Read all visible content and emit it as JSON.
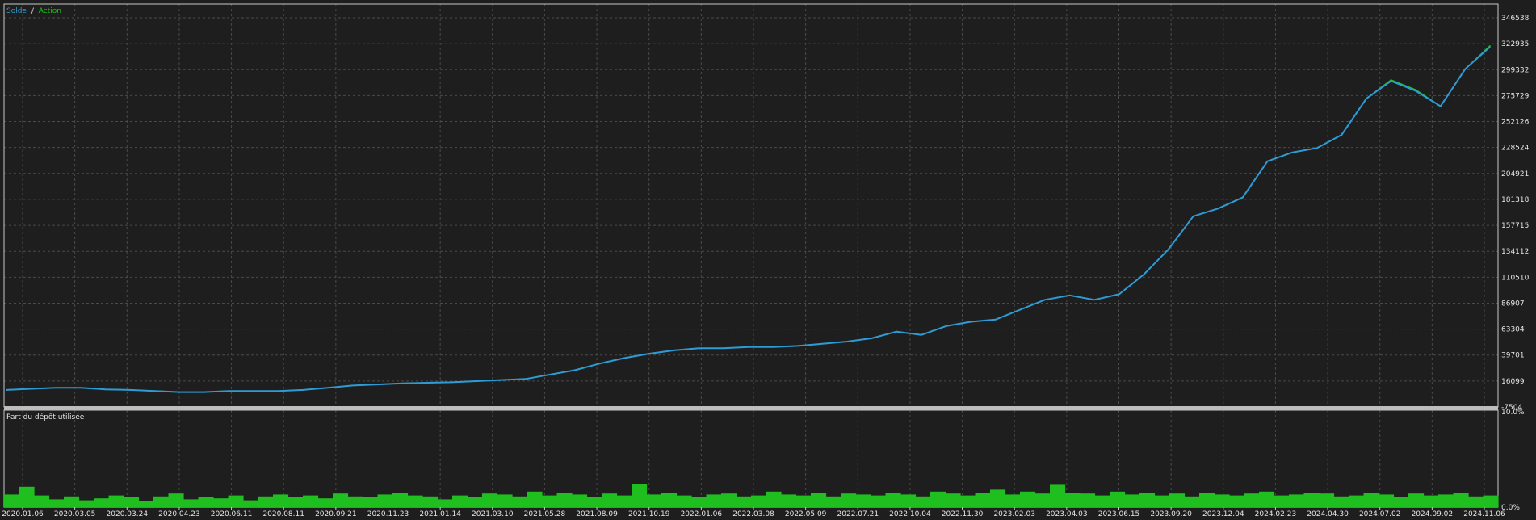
{
  "colors": {
    "background": "#1e1e1e",
    "grid": "#4a4a4a",
    "frame": "#c8c8c8",
    "solde": "#2e9bd6",
    "action": "#1fbf1f",
    "volume": "#1fbf1f",
    "text": "#e6e6e6"
  },
  "chart_data": [
    {
      "type": "line",
      "legend": [
        {
          "name": "Solde",
          "color": "#2e9bd6"
        },
        {
          "name": "/",
          "color": "#e6e6e6"
        },
        {
          "name": "Action",
          "color": "#1fbf1f"
        }
      ],
      "legend_position": "top-left",
      "grid": true,
      "y_axis_position": "right",
      "ylim": [
        -7504,
        346538
      ],
      "y_ticks": [
        "346538",
        "322935",
        "299332",
        "275729",
        "252126",
        "228524",
        "204921",
        "181318",
        "157715",
        "134112",
        "110510",
        "86907",
        "63304",
        "39701",
        "16099",
        "-7504"
      ],
      "x_ticks": [
        "2020.01.06",
        "2020.03.05",
        "2020.03.24",
        "2020.04.23",
        "2020.06.11",
        "2020.08.11",
        "2020.09.21",
        "2020.11.23",
        "2021.01.14",
        "2021.03.10",
        "2021.05.28",
        "2021.08.09",
        "2021.10.19",
        "2022.01.06",
        "2022.03.08",
        "2022.05.09",
        "2022.07.21",
        "2022.10.04",
        "2022.11.30",
        "2023.02.03",
        "2023.04.03",
        "2023.06.15",
        "2023.09.20",
        "2023.12.04",
        "2024.02.23",
        "2024.04.30",
        "2024.07.02",
        "2024.09.02",
        "2024.11.06"
      ],
      "series": [
        {
          "name": "Solde",
          "x": [
            0,
            1,
            2,
            3,
            4,
            5,
            6,
            7,
            8,
            9,
            10,
            11,
            12,
            13,
            14,
            15,
            16,
            17,
            18,
            19,
            20,
            21,
            22,
            23,
            24,
            25,
            26,
            27,
            28,
            29,
            30,
            31,
            32,
            33,
            34,
            35,
            36,
            37,
            38,
            39,
            40,
            41,
            42,
            43,
            44,
            45,
            46,
            47,
            48,
            49,
            50,
            51,
            52,
            53,
            54,
            55,
            56,
            57,
            58,
            59,
            60
          ],
          "values": [
            8000,
            9000,
            10000,
            10000,
            8500,
            8000,
            7000,
            6000,
            6000,
            7000,
            7000,
            7000,
            8000,
            10000,
            12000,
            13000,
            14000,
            14500,
            15000,
            16000,
            17000,
            18000,
            22000,
            26000,
            32000,
            37000,
            41000,
            44000,
            46000,
            46000,
            47000,
            47000,
            48000,
            50000,
            52000,
            55000,
            61000,
            58000,
            66000,
            70000,
            72000,
            81000,
            90000,
            94000,
            90000,
            95000,
            113000,
            136000,
            166000,
            173000,
            183000,
            216000,
            224000,
            228000,
            240000,
            273000,
            289000,
            280000,
            266000,
            300000,
            320000
          ]
        },
        {
          "name": "Action",
          "x": [
            0,
            1,
            2,
            3,
            4,
            5,
            6,
            7,
            8,
            9,
            10,
            11,
            12,
            13,
            14,
            15,
            16,
            17,
            18,
            19,
            20,
            21,
            22,
            23,
            24,
            25,
            26,
            27,
            28,
            29,
            30,
            31,
            32,
            33,
            34,
            35,
            36,
            37,
            38,
            39,
            40,
            41,
            42,
            43,
            44,
            45,
            46,
            47,
            48,
            49,
            50,
            51,
            52,
            53,
            54,
            55,
            56,
            57,
            58,
            59,
            60
          ],
          "values": [
            8000,
            9000,
            10000,
            10000,
            8500,
            8000,
            7000,
            6000,
            6000,
            7000,
            7000,
            7000,
            8000,
            10000,
            12000,
            13000,
            14000,
            14500,
            15000,
            16000,
            17000,
            18000,
            22000,
            26000,
            32000,
            37000,
            41000,
            44000,
            46000,
            46000,
            47000,
            47000,
            48000,
            50000,
            52000,
            55000,
            61000,
            58000,
            66000,
            70000,
            72000,
            81000,
            90000,
            94000,
            90000,
            95000,
            113000,
            136000,
            166000,
            173000,
            183000,
            216000,
            224000,
            228000,
            240000,
            273000,
            290000,
            281000,
            266000,
            300000,
            321000
          ]
        }
      ]
    },
    {
      "type": "bar",
      "title": "Part du dépôt utilisée",
      "y_axis_position": "right",
      "ylim": [
        0,
        10
      ],
      "y_ticks": [
        "10.0%",
        "0.0%"
      ],
      "series": [
        {
          "name": "Part du dépôt utilisée",
          "values": [
            1.3,
            2.1,
            1.2,
            0.8,
            1.1,
            0.7,
            0.9,
            1.2,
            1.0,
            0.6,
            1.1,
            1.4,
            0.8,
            1.0,
            0.9,
            1.2,
            0.7,
            1.1,
            1.3,
            1.0,
            1.2,
            0.9,
            1.4,
            1.1,
            1.0,
            1.3,
            1.5,
            1.2,
            1.1,
            0.8,
            1.2,
            1.0,
            1.4,
            1.3,
            1.1,
            1.6,
            1.2,
            1.5,
            1.3,
            1.0,
            1.4,
            1.2,
            2.4,
            1.3,
            1.5,
            1.2,
            1.0,
            1.3,
            1.4,
            1.1,
            1.2,
            1.6,
            1.3,
            1.2,
            1.5,
            1.1,
            1.4,
            1.3,
            1.2,
            1.5,
            1.3,
            1.1,
            1.6,
            1.4,
            1.2,
            1.5,
            1.8,
            1.3,
            1.6,
            1.4,
            2.3,
            1.5,
            1.4,
            1.2,
            1.6,
            1.3,
            1.5,
            1.2,
            1.4,
            1.1,
            1.5,
            1.3,
            1.2,
            1.4,
            1.6,
            1.2,
            1.3,
            1.5,
            1.4,
            1.1,
            1.2,
            1.5,
            1.3,
            1.0,
            1.4,
            1.2,
            1.3,
            1.5,
            1.1,
            1.2
          ]
        }
      ]
    }
  ]
}
